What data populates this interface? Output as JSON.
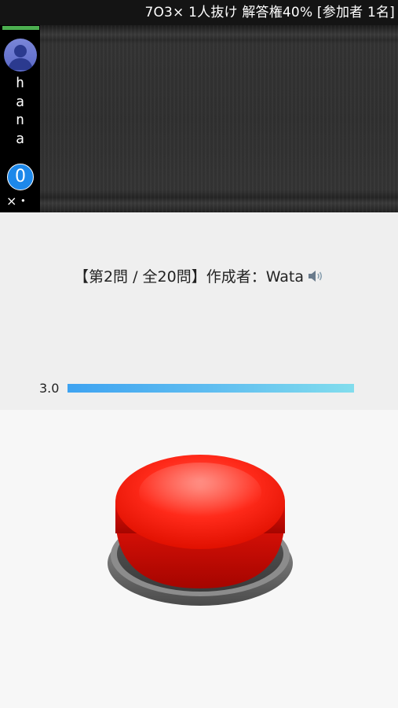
{
  "header": {
    "rule_text": "7O3× 1人抜け 解答権40% [参加者 1名]"
  },
  "players": [
    {
      "name_chars": [
        "h",
        "a",
        "n",
        "a"
      ],
      "score": "0",
      "miss": "×・"
    }
  ],
  "question": {
    "header_text": "【第2問 / 全20問】作成者：Wata"
  },
  "timer": {
    "value_text": "3.0",
    "progress": 1.0
  },
  "colors": {
    "active_indicator": "#4caf50",
    "score_badge": "#1d88ea",
    "buzzer_red": "#ff1a10",
    "timer_start": "#3ea3f1",
    "timer_end": "#82dded"
  },
  "icons": {
    "speaker": "speaker-icon",
    "avatar": "user-avatar-icon"
  }
}
